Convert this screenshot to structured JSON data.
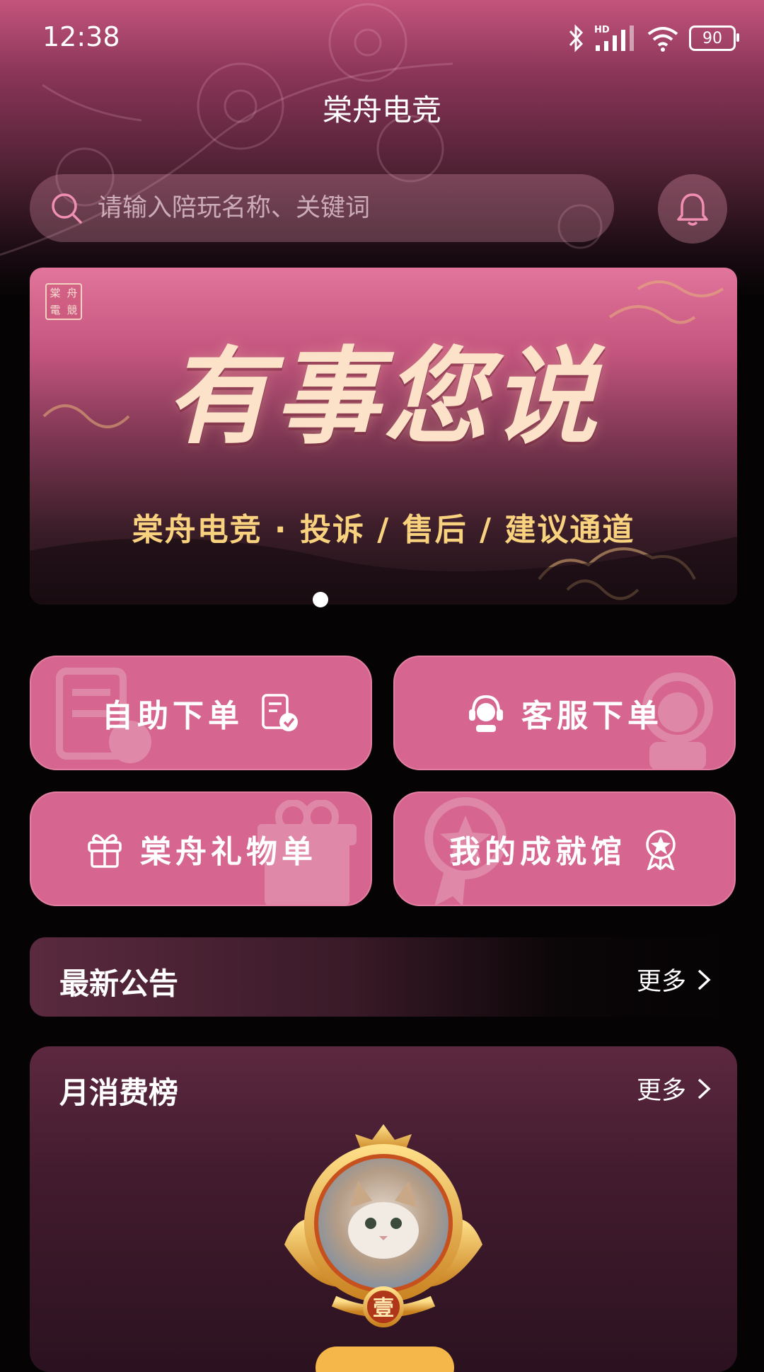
{
  "status_bar": {
    "time": "12:38",
    "network_badge": "HD",
    "battery": "90"
  },
  "app": {
    "title": "棠舟电竞"
  },
  "search": {
    "placeholder": "请输入陪玩名称、关键词"
  },
  "banner": {
    "seal": [
      "棠",
      "舟",
      "電",
      "競"
    ],
    "headline": "有事您说",
    "subtitle": "棠舟电竞 · 投诉 / 售后 / 建议通道",
    "page_count": 1,
    "active_page": 1
  },
  "actions": [
    {
      "label": "自助下单",
      "icon": "order-check-icon"
    },
    {
      "label": "客服下单",
      "icon": "customer-service-icon"
    },
    {
      "label": "棠舟礼物单",
      "icon": "gift-icon"
    },
    {
      "label": "我的成就馆",
      "icon": "medal-icon"
    }
  ],
  "notice": {
    "title": "最新公告",
    "more": "更多"
  },
  "ranking": {
    "title": "月消费榜",
    "more": "更多",
    "top_rank_badge": "壹"
  },
  "colors": {
    "accent": "#d6668f",
    "gold": "#f8d27e",
    "background": "#050304"
  }
}
